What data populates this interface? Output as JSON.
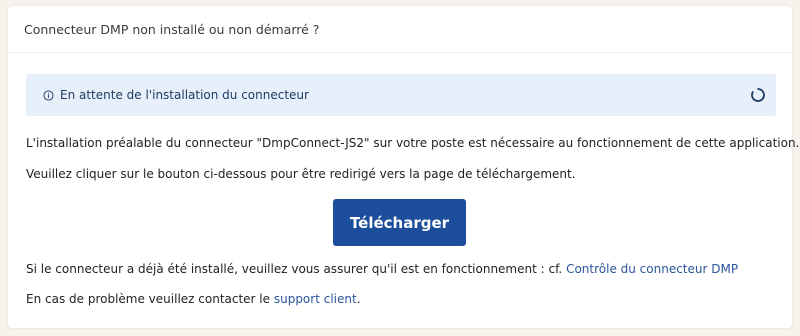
{
  "header": {
    "title": "Connecteur DMP non installé ou non démarré ?"
  },
  "alert": {
    "icon": "info-icon",
    "message": "En attente de l'installation du connecteur",
    "spinner_icon": "spinner-icon"
  },
  "body": {
    "line1": "L'installation préalable du connecteur \"DmpConnect-JS2\" sur votre poste est nécessaire au fonctionnement de cette application.",
    "line2": "Veuillez cliquer sur le bouton ci-dessous pour être redirigé vers la page de téléchargement.",
    "download_button": "Télécharger",
    "line3_prefix": "Si le connecteur a déjà été installé, veuillez vous assurer qu'il est en fonctionnement : cf. ",
    "line3_link": "Contrôle du connecteur DMP",
    "line4_prefix": "En cas de problème veuillez contacter le ",
    "line4_link": "support client",
    "line4_suffix": "."
  },
  "colors": {
    "background": "#f7f1ec",
    "alert_bg": "#e7f0fa",
    "button": "#1d4e9c",
    "link": "#2c5599"
  }
}
